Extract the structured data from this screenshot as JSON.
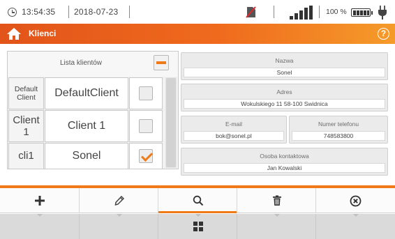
{
  "status": {
    "time": "13:54:35",
    "date": "2018-07-23",
    "battery_percent": "100 %",
    "battery_level": 1.0,
    "signal_bars": 5,
    "icons": [
      "clock-icon",
      "no-sd-card-icon",
      "signal-strength-icon",
      "battery-icon",
      "plug-icon"
    ]
  },
  "titlebar": {
    "title": "Klienci",
    "home_icon": "home-icon",
    "help_label": "?"
  },
  "client_list": {
    "header": "Lista klientów",
    "rows": [
      {
        "short": "Default Client",
        "name": "DefaultClient",
        "checked": false
      },
      {
        "short": "Client 1",
        "name": "Client 1",
        "checked": false
      },
      {
        "short": "cli1",
        "name": "Sonel",
        "checked": true
      }
    ]
  },
  "details": {
    "name": {
      "label": "Nazwa",
      "value": "Sonel"
    },
    "address": {
      "label": "Adres",
      "value": "Wokulskiego 11 58-100 Swidnica"
    },
    "email": {
      "label": "E-mail",
      "value": "bok@sonel.pl"
    },
    "phone": {
      "label": "Numer telefonu",
      "value": "748583800"
    },
    "contact": {
      "label": "Osoba kontaktowa",
      "value": "Jan Kowalski"
    }
  },
  "toolbar": {
    "buttons": [
      {
        "name": "add",
        "icon": "plus-icon",
        "active": false
      },
      {
        "name": "edit",
        "icon": "pencil-icon",
        "active": false
      },
      {
        "name": "search",
        "icon": "search-icon",
        "active": true
      },
      {
        "name": "delete",
        "icon": "trash-icon",
        "active": false
      },
      {
        "name": "close",
        "icon": "close-circle-icon",
        "active": false
      }
    ]
  },
  "bottombar": {
    "center_icon": "grid-menu-icon"
  },
  "colors": {
    "accent": "#f07a18",
    "title_gradient_start": "#e2541a",
    "title_gradient_end": "#f59b2a"
  }
}
